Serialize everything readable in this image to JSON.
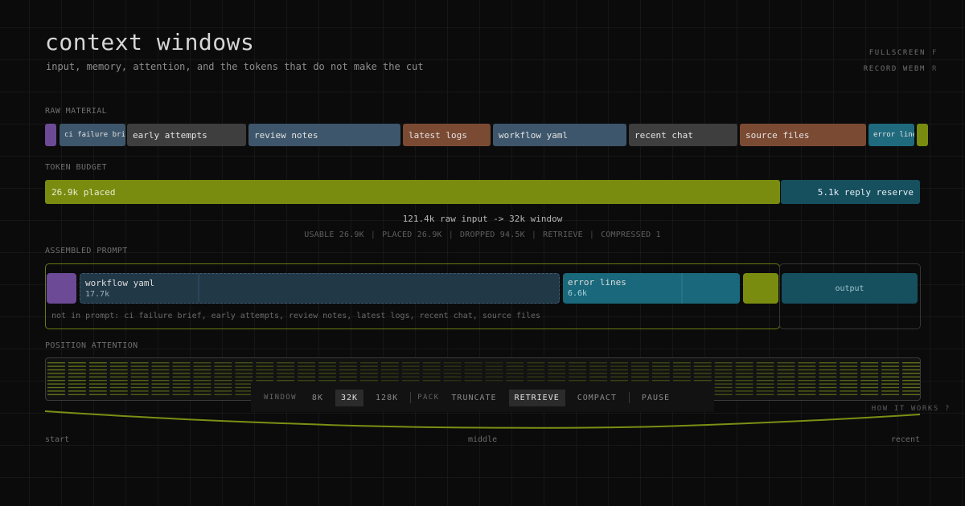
{
  "header": {
    "title": "context windows",
    "subtitle": "input, memory, attention, and the tokens that do not make the cut",
    "fullscreen_label": "FULLSCREEN",
    "fullscreen_key": "F",
    "record_label": "RECORD WEBM",
    "record_key": "R"
  },
  "raw_material": {
    "label": "RAW MATERIAL",
    "items": [
      {
        "label": "",
        "color": "#6c4a96"
      },
      {
        "label": "ci failure brief",
        "color": "#3d566b"
      },
      {
        "label": "early attempts",
        "color": "#3e3e3e"
      },
      {
        "label": "review notes",
        "color": "#3d566b"
      },
      {
        "label": "latest logs",
        "color": "#7b4a33"
      },
      {
        "label": "workflow yaml",
        "color": "#3d566b"
      },
      {
        "label": "recent chat",
        "color": "#3e3e3e"
      },
      {
        "label": "source files",
        "color": "#7b4a33"
      },
      {
        "label": "error lines",
        "color": "#1f6a7d"
      },
      {
        "label": "",
        "color": "#7a8c10"
      }
    ]
  },
  "token_budget": {
    "label": "TOKEN BUDGET",
    "placed_label": "26.9k placed",
    "reserve_label": "5.1k reply reserve",
    "placed_fraction": 0.84,
    "summary": "121.4k raw input -> 32k window",
    "stats": {
      "usable": "USABLE 26.9K",
      "placed": "PLACED 26.9K",
      "dropped": "DROPPED 94.5K",
      "mode": "RETRIEVE",
      "compressed": "COMPRESSED 1"
    }
  },
  "assembled_prompt": {
    "label": "ASSEMBLED PROMPT",
    "blocks": [
      {
        "name": "workflow yaml",
        "tokens": "17.7k"
      },
      {
        "name": "error lines",
        "tokens": "6.6k"
      }
    ],
    "output_label": "output",
    "not_in_prompt": "not in prompt: ci failure brief, early attempts, review notes, latest logs, recent chat, source files"
  },
  "position_attention": {
    "label": "POSITION ATTENTION",
    "start_label": "start",
    "middle_label": "middle",
    "recent_label": "recent",
    "accent": "#a4c41c"
  },
  "toolbar": {
    "window_label": "WINDOW",
    "window_options": [
      "8K",
      "32K",
      "128K"
    ],
    "window_selected": "32K",
    "pack_label": "PACK",
    "pack_options": [
      "TRUNCATE",
      "RETRIEVE",
      "COMPACT"
    ],
    "pack_selected": "RETRIEVE",
    "pause_label": "PAUSE"
  },
  "how_it_works": "HOW IT WORKS ?"
}
